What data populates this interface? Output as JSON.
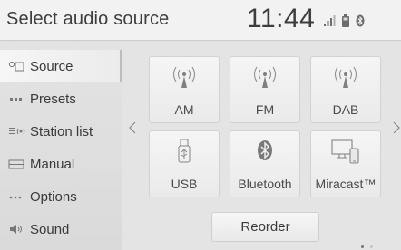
{
  "header": {
    "title": "Select audio source",
    "clock": "11:44",
    "status_icons": [
      "signal-bars-icon",
      "battery-icon",
      "bluetooth-icon"
    ]
  },
  "sidebar": {
    "items": [
      {
        "label": "Source",
        "icon": "source-icon",
        "active": true
      },
      {
        "label": "Presets",
        "icon": "presets-icon",
        "active": false
      },
      {
        "label": "Station list",
        "icon": "station-list-icon",
        "active": false
      },
      {
        "label": "Manual",
        "icon": "manual-icon",
        "active": false
      },
      {
        "label": "Options",
        "icon": "options-icon",
        "active": false
      },
      {
        "label": "Sound",
        "icon": "speaker-icon",
        "active": false
      }
    ]
  },
  "sources": [
    {
      "label": "AM",
      "icon": "broadcast-antenna-icon"
    },
    {
      "label": "FM",
      "icon": "broadcast-antenna-icon"
    },
    {
      "label": "DAB",
      "icon": "broadcast-antenna-icon"
    },
    {
      "label": "USB",
      "icon": "usb-icon"
    },
    {
      "label": "Bluetooth",
      "icon": "bluetooth-icon"
    },
    {
      "label": "Miracast™",
      "icon": "miracast-icon"
    }
  ],
  "pager": {
    "pages": 2,
    "current": 1
  },
  "reorder_label": "Reorder",
  "colors": {
    "background": "#dedede",
    "tile": "#f0f0f0",
    "text": "#3a3a3a",
    "icon": "#7a7a7a"
  }
}
